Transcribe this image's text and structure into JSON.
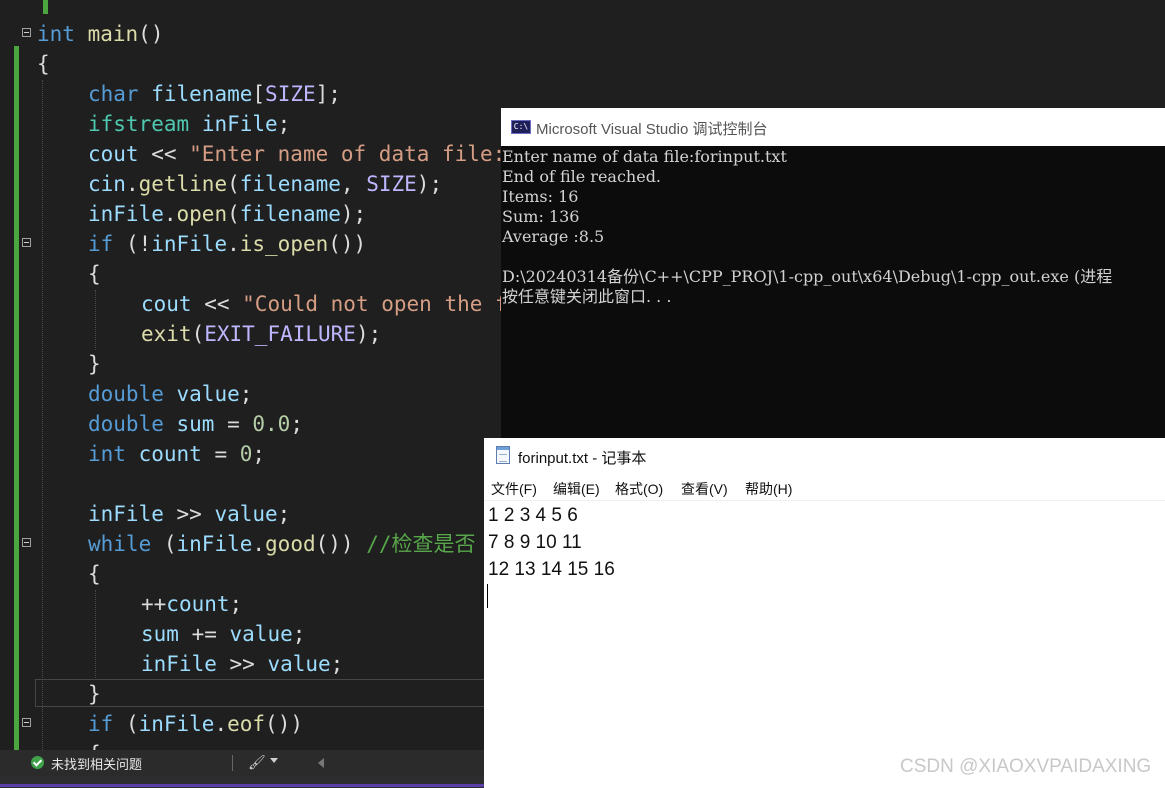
{
  "editor": {
    "lines": [
      [
        [
          "kw",
          "int"
        ],
        [
          "pl",
          " "
        ],
        [
          "fn",
          "main"
        ],
        [
          "pl",
          "()"
        ]
      ],
      [
        [
          "pl",
          "{"
        ]
      ],
      [
        [
          "kw",
          "char"
        ],
        [
          "pl",
          " "
        ],
        [
          "var",
          "filename"
        ],
        [
          "pl",
          "["
        ],
        [
          "mac",
          "SIZE"
        ],
        [
          "pl",
          "];"
        ]
      ],
      [
        [
          "ty",
          "ifstream"
        ],
        [
          "pl",
          " "
        ],
        [
          "var",
          "inFile"
        ],
        [
          "pl",
          ";"
        ]
      ],
      [
        [
          "var",
          "cout"
        ],
        [
          "pl",
          " << "
        ],
        [
          "str",
          "\"Enter name of data file: \""
        ],
        [
          "pl",
          ";"
        ]
      ],
      [
        [
          "var",
          "cin"
        ],
        [
          "pl",
          "."
        ],
        [
          "fn",
          "getline"
        ],
        [
          "pl",
          "("
        ],
        [
          "var",
          "filename"
        ],
        [
          "pl",
          ", "
        ],
        [
          "mac",
          "SIZE"
        ],
        [
          "pl",
          ");"
        ]
      ],
      [
        [
          "var",
          "inFile"
        ],
        [
          "pl",
          "."
        ],
        [
          "fn",
          "open"
        ],
        [
          "pl",
          "("
        ],
        [
          "var",
          "filename"
        ],
        [
          "pl",
          ");"
        ]
      ],
      [
        [
          "kw",
          "if"
        ],
        [
          "pl",
          " (!"
        ],
        [
          "var",
          "inFile"
        ],
        [
          "pl",
          "."
        ],
        [
          "fn",
          "is_open"
        ],
        [
          "pl",
          "())"
        ]
      ],
      [
        [
          "pl",
          "{"
        ]
      ],
      [
        [
          "var",
          "cout"
        ],
        [
          "pl",
          " << "
        ],
        [
          "str",
          "\"Could not open the file \""
        ],
        [
          "pl",
          ";"
        ]
      ],
      [
        [
          "fn",
          "exit"
        ],
        [
          "pl",
          "("
        ],
        [
          "mac",
          "EXIT_FAILURE"
        ],
        [
          "pl",
          ");"
        ]
      ],
      [
        [
          "pl",
          "}"
        ]
      ],
      [
        [
          "kw",
          "double"
        ],
        [
          "pl",
          " "
        ],
        [
          "var",
          "value"
        ],
        [
          "pl",
          ";"
        ]
      ],
      [
        [
          "kw",
          "double"
        ],
        [
          "pl",
          " "
        ],
        [
          "var",
          "sum"
        ],
        [
          "pl",
          " = "
        ],
        [
          "num",
          "0.0"
        ],
        [
          "pl",
          ";"
        ]
      ],
      [
        [
          "kw",
          "int"
        ],
        [
          "pl",
          " "
        ],
        [
          "var",
          "count"
        ],
        [
          "pl",
          " = "
        ],
        [
          "num",
          "0"
        ],
        [
          "pl",
          ";"
        ]
      ],
      [],
      [
        [
          "var",
          "inFile"
        ],
        [
          "pl",
          " >> "
        ],
        [
          "var",
          "value"
        ],
        [
          "pl",
          ";"
        ]
      ],
      [
        [
          "kw",
          "while"
        ],
        [
          "pl",
          " ("
        ],
        [
          "var",
          "inFile"
        ],
        [
          "pl",
          "."
        ],
        [
          "fn",
          "good"
        ],
        [
          "pl",
          "()) "
        ],
        [
          "cm",
          "//检查是否"
        ]
      ],
      [
        [
          "pl",
          "{"
        ]
      ],
      [
        [
          "pl",
          "++"
        ],
        [
          "var",
          "count"
        ],
        [
          "pl",
          ";"
        ]
      ],
      [
        [
          "var",
          "sum"
        ],
        [
          "pl",
          " += "
        ],
        [
          "var",
          "value"
        ],
        [
          "pl",
          ";"
        ]
      ],
      [
        [
          "var",
          "inFile"
        ],
        [
          "pl",
          " >> "
        ],
        [
          "var",
          "value"
        ],
        [
          "pl",
          ";"
        ]
      ],
      [
        [
          "pl",
          "}"
        ]
      ],
      [
        [
          "kw",
          "if"
        ],
        [
          "pl",
          " ("
        ],
        [
          "var",
          "inFile"
        ],
        [
          "pl",
          "."
        ],
        [
          "fn",
          "eof"
        ],
        [
          "pl",
          "())"
        ]
      ],
      [
        [
          "pl",
          "{"
        ]
      ]
    ]
  },
  "statusbar": {
    "issues_text": "未找到相关问题"
  },
  "console": {
    "title": "Microsoft Visual Studio 调试控制台",
    "icon_text": "C:\\",
    "lines": [
      "Enter name of data file:forinput.txt",
      "End of file reached.",
      "Items: 16",
      "Sum: 136",
      "Average :8.5",
      "",
      "D:\\20240314备份\\C++\\CPP_PROJ\\1-cpp_out\\x64\\Debug\\1-cpp_out.exe (进程",
      "按任意键关闭此窗口. . ."
    ]
  },
  "notepad": {
    "title": "forinput.txt - 记事本",
    "menu": [
      "文件(F)",
      "编辑(E)",
      "格式(O)",
      "查看(V)",
      "帮助(H)"
    ],
    "lines": [
      "1 2 3 4 5 6",
      "7 8 9 10 11",
      "12 13 14 15 16"
    ]
  },
  "watermark": "CSDN @XIAOXVPAIDAXING",
  "icons": {
    "status_ok": "check-circle-icon",
    "brush": "brush-icon",
    "console": "console-app-icon",
    "notepad": "notepad-app-icon"
  }
}
